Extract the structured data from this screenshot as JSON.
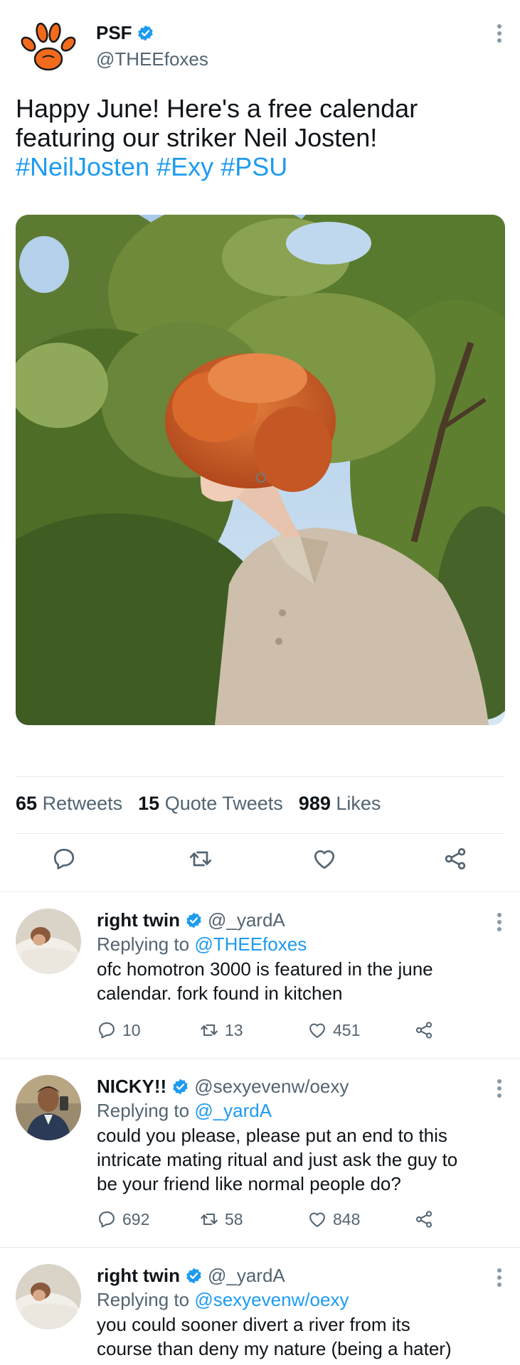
{
  "tweet": {
    "author_name": "PSF",
    "handle": "@THEEfoxes",
    "text_line1": "Happy June! Here's a free calendar",
    "text_line2": "featuring our striker Neil Josten!",
    "hashtags": [
      "#NeilJosten",
      "#Exy",
      "#PSU"
    ],
    "stats": {
      "retweets_count": "65",
      "retweets_label": "Retweets",
      "quotes_count": "15",
      "quotes_label": "Quote Tweets",
      "likes_count": "989",
      "likes_label": "Likes"
    }
  },
  "replies": [
    {
      "name": "right twin",
      "handle": "@_yardA",
      "replying_label": "Replying to",
      "replying_to": "@THEEfoxes",
      "lines": [
        "ofc homotron 3000 is featured in the june",
        "calendar. fork found in kitchen"
      ],
      "replies": "10",
      "retweets": "13",
      "likes": "451"
    },
    {
      "name": "NICKY!!",
      "handle": "@sexyevenw/oexy",
      "replying_label": "Replying to",
      "replying_to": "@_yardA",
      "lines": [
        "could you please, please put an end to this",
        "intricate mating ritual and just ask the guy to",
        "be your friend like normal people do?"
      ],
      "replies": "692",
      "retweets": "58",
      "likes": "848"
    },
    {
      "name": "right twin",
      "handle": "@_yardA",
      "replying_label": "Replying to",
      "replying_to": "@sexyevenw/oexy",
      "lines": [
        "you could sooner divert a river from its",
        "course than deny my nature (being a hater)"
      ]
    }
  ],
  "colors": {
    "accent": "#1d9bf0",
    "muted": "#536471",
    "fox_orange": "#f26b1d"
  },
  "icons": [
    "fox-paw-logo",
    "verified-badge-icon",
    "more-dots-icon",
    "reply-icon",
    "retweet-icon",
    "like-icon",
    "share-icon"
  ]
}
